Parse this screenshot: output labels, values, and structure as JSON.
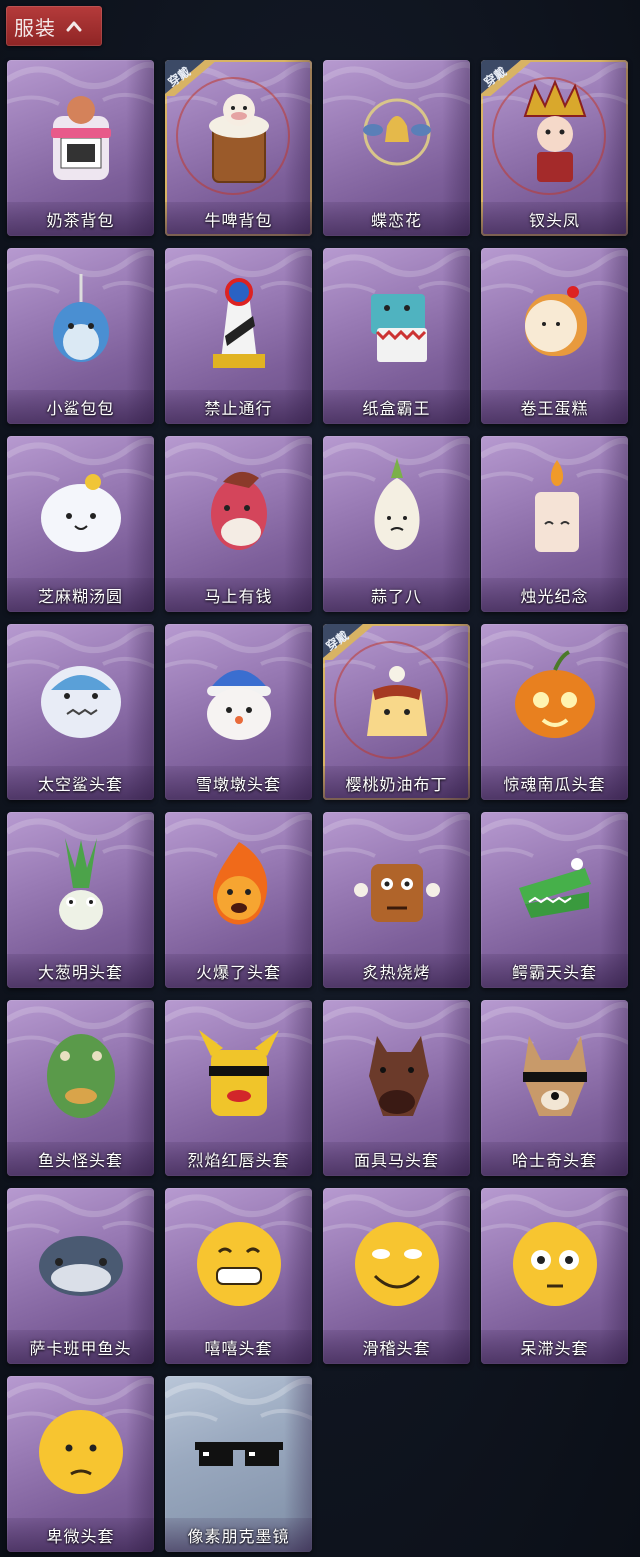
{
  "section": {
    "title": "服装",
    "collapse_icon": "chevron-up-icon"
  },
  "badge_label": "穿戴",
  "colors": {
    "header_red": "#a83232",
    "card_purple": "#9a7cb6",
    "worn_gold": "#d8b364",
    "worn_ring_red": "#c0392b"
  },
  "items": [
    {
      "label": "奶茶背包",
      "icon": "milk-tea-backpack-icon",
      "worn": false,
      "faded": false
    },
    {
      "label": "牛啤背包",
      "icon": "cow-beer-backpack-icon",
      "worn": true,
      "faded": false
    },
    {
      "label": "蝶恋花",
      "icon": "butterfly-bell-icon",
      "worn": false,
      "faded": false
    },
    {
      "label": "钗头凤",
      "icon": "phoenix-crown-icon",
      "worn": true,
      "faded": false
    },
    {
      "label": "小鲨包包",
      "icon": "shark-bag-icon",
      "worn": false,
      "faded": false
    },
    {
      "label": "禁止通行",
      "icon": "no-entry-sign-icon",
      "worn": false,
      "faded": false
    },
    {
      "label": "纸盒霸王",
      "icon": "box-dino-icon",
      "worn": false,
      "faded": false
    },
    {
      "label": "卷王蛋糕",
      "icon": "roll-cake-icon",
      "worn": false,
      "faded": false
    },
    {
      "label": "芝麻糊汤圆",
      "icon": "rice-ball-icon",
      "worn": false,
      "faded": false
    },
    {
      "label": "马上有钱",
      "icon": "horse-head-icon",
      "worn": false,
      "faded": false
    },
    {
      "label": "蒜了八",
      "icon": "garlic-icon",
      "worn": false,
      "faded": false
    },
    {
      "label": "烛光纪念",
      "icon": "candle-icon",
      "worn": false,
      "faded": false
    },
    {
      "label": "太空鲨头套",
      "icon": "space-shark-icon",
      "worn": false,
      "faded": false
    },
    {
      "label": "雪墩墩头套",
      "icon": "snowman-icon",
      "worn": false,
      "faded": false
    },
    {
      "label": "樱桃奶油布丁",
      "icon": "pudding-icon",
      "worn": true,
      "faded": false
    },
    {
      "label": "惊魂南瓜头套",
      "icon": "pumpkin-icon",
      "worn": false,
      "faded": false
    },
    {
      "label": "大葱明头套",
      "icon": "scallion-icon",
      "worn": false,
      "faded": false
    },
    {
      "label": "火爆了头套",
      "icon": "fireball-icon",
      "worn": false,
      "faded": false
    },
    {
      "label": "炙热烧烤",
      "icon": "bbq-meat-icon",
      "worn": false,
      "faded": false
    },
    {
      "label": "鳄霸天头套",
      "icon": "crocodile-icon",
      "worn": false,
      "faded": false
    },
    {
      "label": "鱼头怪头套",
      "icon": "fish-head-icon",
      "worn": false,
      "faded": false
    },
    {
      "label": "烈焰红唇头套",
      "icon": "red-lips-icon",
      "worn": false,
      "faded": false
    },
    {
      "label": "面具马头套",
      "icon": "horse-mask-icon",
      "worn": false,
      "faded": false
    },
    {
      "label": "哈士奇头套",
      "icon": "husky-icon",
      "worn": false,
      "faded": false
    },
    {
      "label": "萨卡班甲鱼头",
      "icon": "armored-fish-icon",
      "worn": false,
      "faded": false
    },
    {
      "label": "嘻嘻头套",
      "icon": "grin-emoji-icon",
      "worn": false,
      "faded": false
    },
    {
      "label": "滑稽头套",
      "icon": "funny-emoji-icon",
      "worn": false,
      "faded": false
    },
    {
      "label": "呆滞头套",
      "icon": "dazed-emoji-icon",
      "worn": false,
      "faded": false
    },
    {
      "label": "卑微头套",
      "icon": "humble-emoji-icon",
      "worn": false,
      "faded": false
    },
    {
      "label": "像素朋克墨镜",
      "icon": "pixel-sunglasses-icon",
      "worn": false,
      "faded": true
    }
  ]
}
